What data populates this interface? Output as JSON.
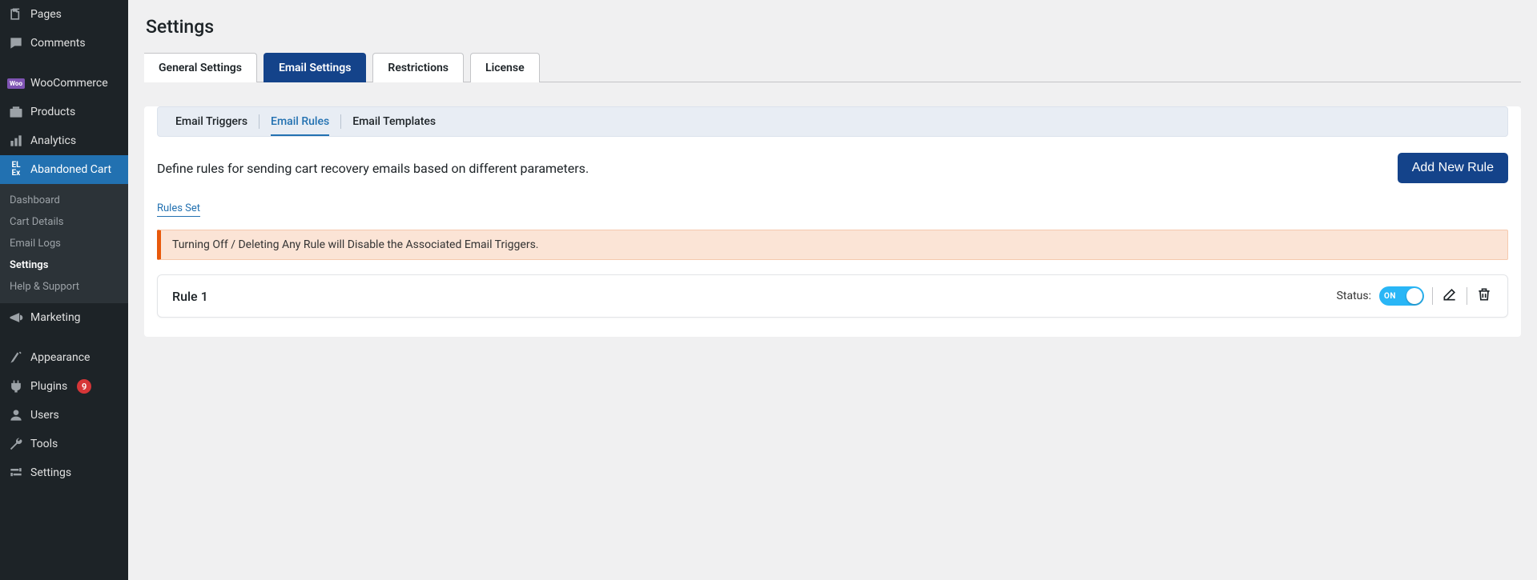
{
  "sidebar": {
    "items": [
      {
        "label": "Pages"
      },
      {
        "label": "Comments"
      },
      {
        "label": "WooCommerce"
      },
      {
        "label": "Products"
      },
      {
        "label": "Analytics"
      },
      {
        "label": "Abandoned Cart"
      },
      {
        "label": "Marketing"
      },
      {
        "label": "Appearance"
      },
      {
        "label": "Plugins",
        "badge": "9"
      },
      {
        "label": "Users"
      },
      {
        "label": "Tools"
      },
      {
        "label": "Settings"
      }
    ],
    "sub": [
      {
        "label": "Dashboard"
      },
      {
        "label": "Cart Details"
      },
      {
        "label": "Email Logs"
      },
      {
        "label": "Settings"
      },
      {
        "label": "Help & Support"
      }
    ]
  },
  "page": {
    "title": "Settings"
  },
  "tabs": [
    {
      "label": "General Settings"
    },
    {
      "label": "Email Settings"
    },
    {
      "label": "Restrictions"
    },
    {
      "label": "License"
    }
  ],
  "subtabs": [
    {
      "label": "Email Triggers"
    },
    {
      "label": "Email Rules"
    },
    {
      "label": "Email Templates"
    }
  ],
  "content": {
    "description": "Define rules for sending cart recovery emails based on different parameters.",
    "add_button": "Add New Rule",
    "rules_set_label": "Rules Set",
    "warning": "Turning Off / Deleting Any Rule will Disable the Associated Email Triggers.",
    "rule": {
      "name": "Rule 1",
      "status_label": "Status:",
      "toggle_text": "ON"
    }
  }
}
